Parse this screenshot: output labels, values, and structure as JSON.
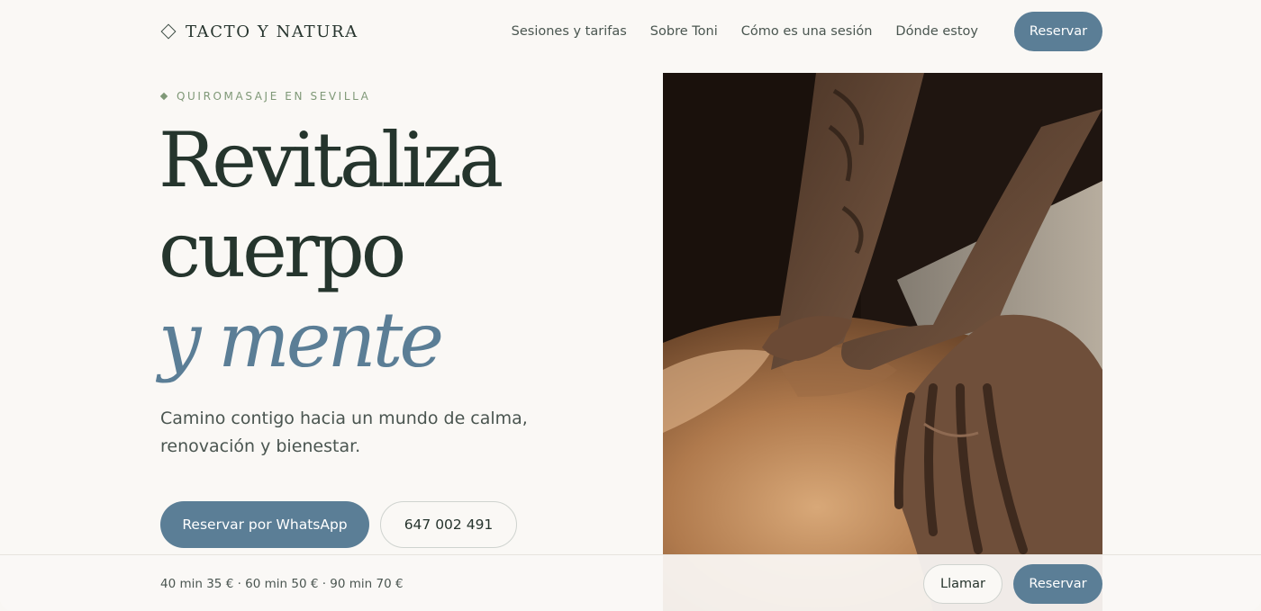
{
  "brand": {
    "name": "TACTO Y NATURA",
    "logo_icon": "diamond-outline-icon"
  },
  "nav": {
    "links": [
      "Sesiones y tarifas",
      "Sobre Toni",
      "Cómo es una sesión",
      "Dónde estoy"
    ],
    "cta": "Reservar"
  },
  "hero": {
    "eyebrow": "QUIROMASAJE EN SEVILLA",
    "headline": {
      "line1": "Revitaliza",
      "line2": "cuerpo",
      "line3": "y mente"
    },
    "subtitle": "Camino contigo hacia un mundo de calma, renovación y bienestar.",
    "cta_whatsapp": "Reservar por WhatsApp",
    "cta_phone": "647 002 491",
    "image": "massage-hands-photo"
  },
  "bottom_bar": {
    "prices": "40 min 35 € · 60 min 50 € · 90 min 70 €",
    "call": "Llamar",
    "book": "Reservar"
  },
  "colors": {
    "accent": "#5b7e96",
    "headline": "#25352d",
    "eyebrow": "#7f9877",
    "background": "#faf8f5"
  }
}
